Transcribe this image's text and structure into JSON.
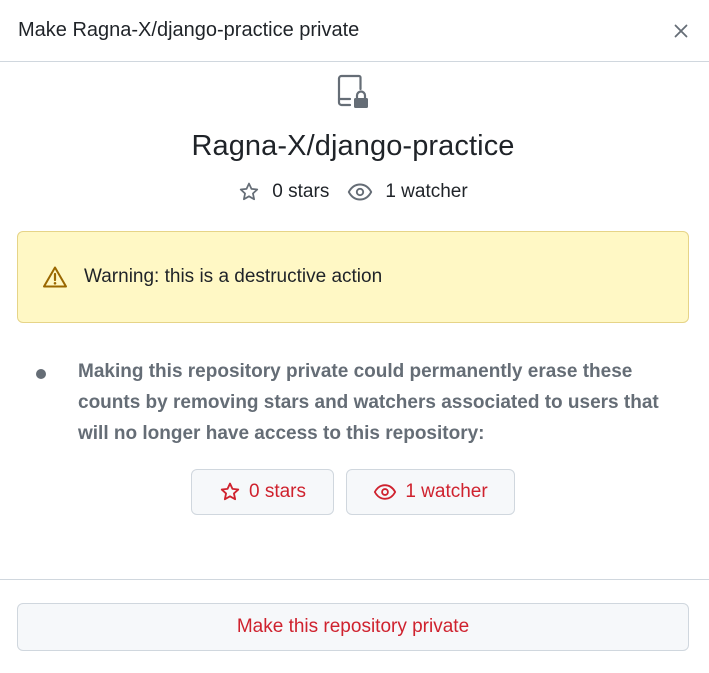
{
  "dialog": {
    "title": "Make Ragna-X/django-practice private",
    "close_icon": "x-icon"
  },
  "repo": {
    "icon": "repo-locked-icon",
    "name": "Ragna-X/django-practice",
    "stars_label": "0 stars",
    "watchers_label": "1 watcher"
  },
  "warning": {
    "icon": "alert-triangle-icon",
    "text": "Warning: this is a destructive action"
  },
  "notice": {
    "text": "Making this repository private could permanently erase these counts by removing stars and watchers associated to users that will no longer have access to this repository:"
  },
  "count_buttons": {
    "stars_label": "0 stars",
    "watchers_label": "1 watcher"
  },
  "footer": {
    "confirm_label": "Make this repository private"
  },
  "colors": {
    "danger": "#cf222e",
    "warning_bg": "#fff8c5",
    "warning_border": "#e6d488",
    "muted": "#656d76",
    "border": "#d0d7de",
    "button_bg": "#f6f8fa"
  }
}
